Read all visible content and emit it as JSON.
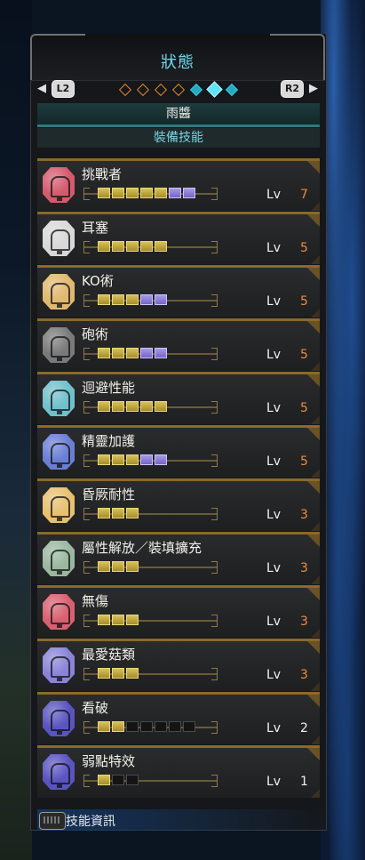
{
  "header": {
    "title": "狀態",
    "left_button": "L2",
    "right_button": "R2",
    "left_arrow": "◀",
    "right_arrow": "▶"
  },
  "character": {
    "name": "雨醬"
  },
  "section": {
    "label": "裝備技能"
  },
  "skills": [
    {
      "name": "挑戰者",
      "lv_label": "Lv",
      "level": "7",
      "max": 7,
      "gem_color": "#d45a6e",
      "level_color": "#f08a3a"
    },
    {
      "name": "耳塞",
      "lv_label": "Lv",
      "level": "5",
      "max": 5,
      "gem_color": "#d8d8d8",
      "level_color": "#f08a3a"
    },
    {
      "name": "KO術",
      "lv_label": "Lv",
      "level": "5",
      "max": 5,
      "gem_color": "#e0b870",
      "level_color": "#f08a3a"
    },
    {
      "name": "砲術",
      "lv_label": "Lv",
      "level": "5",
      "max": 5,
      "gem_color": "#7a7a7a",
      "level_color": "#f08a3a"
    },
    {
      "name": "迴避性能",
      "lv_label": "Lv",
      "level": "5",
      "max": 5,
      "gem_color": "#70c0cc",
      "level_color": "#f08a3a"
    },
    {
      "name": "精靈加護",
      "lv_label": "Lv",
      "level": "5",
      "max": 5,
      "gem_color": "#6a7ed4",
      "level_color": "#f08a3a"
    },
    {
      "name": "昏厥耐性",
      "lv_label": "Lv",
      "level": "3",
      "max": 3,
      "gem_color": "#e8c070",
      "level_color": "#f08a3a"
    },
    {
      "name": "屬性解放／裝填擴充",
      "lv_label": "Lv",
      "level": "3",
      "max": 3,
      "gem_color": "#9ab8a0",
      "level_color": "#f08a3a"
    },
    {
      "name": "無傷",
      "lv_label": "Lv",
      "level": "3",
      "max": 3,
      "gem_color": "#d86070",
      "level_color": "#f08a3a"
    },
    {
      "name": "最愛菇類",
      "lv_label": "Lv",
      "level": "3",
      "max": 3,
      "gem_color": "#8a84d8",
      "level_color": "#f08a3a"
    },
    {
      "name": "看破",
      "lv_label": "Lv",
      "level": "2",
      "max": 7,
      "gem_color": "#5a54c0",
      "level_color": "#f0f0f0"
    },
    {
      "name": "弱點特效",
      "lv_label": "Lv",
      "level": "1",
      "max": 3,
      "gem_color": "#5a54c0",
      "level_color": "#f0f0f0"
    }
  ],
  "footer": {
    "label": "技能資訊"
  }
}
